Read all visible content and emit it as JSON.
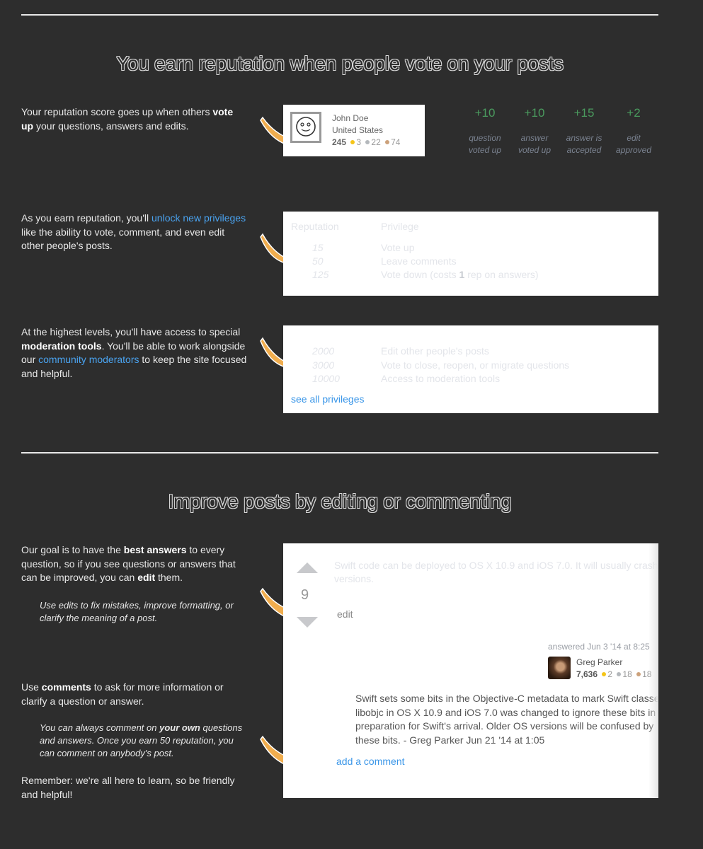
{
  "section1": {
    "title": "You earn reputation when people vote on your posts",
    "para1": {
      "pre": "Your reputation score goes up when others ",
      "bold": "vote up",
      "post": " your questions, answers and edits."
    },
    "user_card": {
      "name": "John Doe",
      "location": "United States",
      "reputation": "245",
      "badges": {
        "gold": "3",
        "silver": "22",
        "bronze": "74"
      },
      "avatar_icon": "smiley-face-icon"
    },
    "gains": [
      {
        "value": "+10",
        "label1": "question",
        "label2": "voted up"
      },
      {
        "value": "+10",
        "label1": "answer",
        "label2": "voted up"
      },
      {
        "value": "+15",
        "label1": "answer is",
        "label2": "accepted"
      },
      {
        "value": "+2",
        "label1": "edit",
        "label2": "approved"
      }
    ],
    "para2": {
      "pre": "As you earn reputation, you'll ",
      "link": "unlock new privileges",
      "post": " like the ability to vote, comment, and even edit other people's posts."
    },
    "privileges_header": {
      "reputation": "Reputation",
      "privilege": "Privilege"
    },
    "privileges_basic": [
      {
        "rep": "15",
        "privilege": "Vote up"
      },
      {
        "rep": "50",
        "privilege": "Leave comments"
      },
      {
        "rep": "125",
        "privilege_pre": "Vote down (costs ",
        "privilege_bold": "1",
        "privilege_post": " rep on answers)"
      }
    ],
    "para3": {
      "pre": "At the highest levels, you'll have access to special ",
      "bold": "moderation tools",
      "mid": ". You'll be able to work alongside our ",
      "link": "community moderators",
      "post": " to keep the site focused and helpful."
    },
    "privileges_advanced": [
      {
        "rep": "2000",
        "privilege": "Edit other people's posts"
      },
      {
        "rep": "3000",
        "privilege": "Vote to close, reopen, or migrate questions"
      },
      {
        "rep": "10000",
        "privilege": "Access to moderation tools"
      }
    ],
    "see_all_link": "see all privileges"
  },
  "section2": {
    "title": "Improve posts by editing or commenting",
    "para1": {
      "pre": "Our goal is to have the ",
      "bold1": "best answers",
      "mid": " to every question, so if you see questions or answers that can be improved, you can ",
      "bold2": "edit",
      "post": " them."
    },
    "note1": "Use edits to fix mistakes, improve formatting, or clarify the meaning of a post.",
    "para2": {
      "pre": "Use ",
      "bold": "comments",
      "post": " to ask for more information or clarify a question or answer."
    },
    "note2": {
      "pre": "You can always comment on ",
      "bold": "your own",
      "post": " questions and answers. Once you earn 50 reputation, you can comment on anybody's post."
    },
    "para3": "Remember: we're all here to learn, so be friendly and helpful!",
    "post": {
      "score": "9",
      "text_line1": "Swift code can be deployed to OS X 10.9 and iOS 7.0. It will usually crash on older",
      "text_line2": "versions.",
      "edit_link": "edit",
      "answered": "answered Jun 3 '14 at 8:25",
      "author": "Greg Parker",
      "author_rep": "7,636",
      "author_badges": {
        "gold": "2",
        "silver": "18",
        "bronze": "18"
      },
      "comment_lines": [
        "Swift sets some bits in the Objective-C metadata to mark Swift classes.",
        "libobjc in OS X 10.9 and iOS 7.0 was changed to ignore these bits in",
        "preparation for Swift's arrival. Older OS versions will be confused by",
        "these bits. - Greg Parker Jun 21 '14 at 1:05"
      ],
      "add_comment_link": "add a comment"
    }
  },
  "colors": {
    "background": "#2d2d2d",
    "link": "#4aa3f0",
    "gain_green": "#4a9a5e",
    "arrow_orange": "#f0ad4e",
    "gold": "#f5c518",
    "silver": "#b4b8bc",
    "bronze": "#cca17b"
  }
}
